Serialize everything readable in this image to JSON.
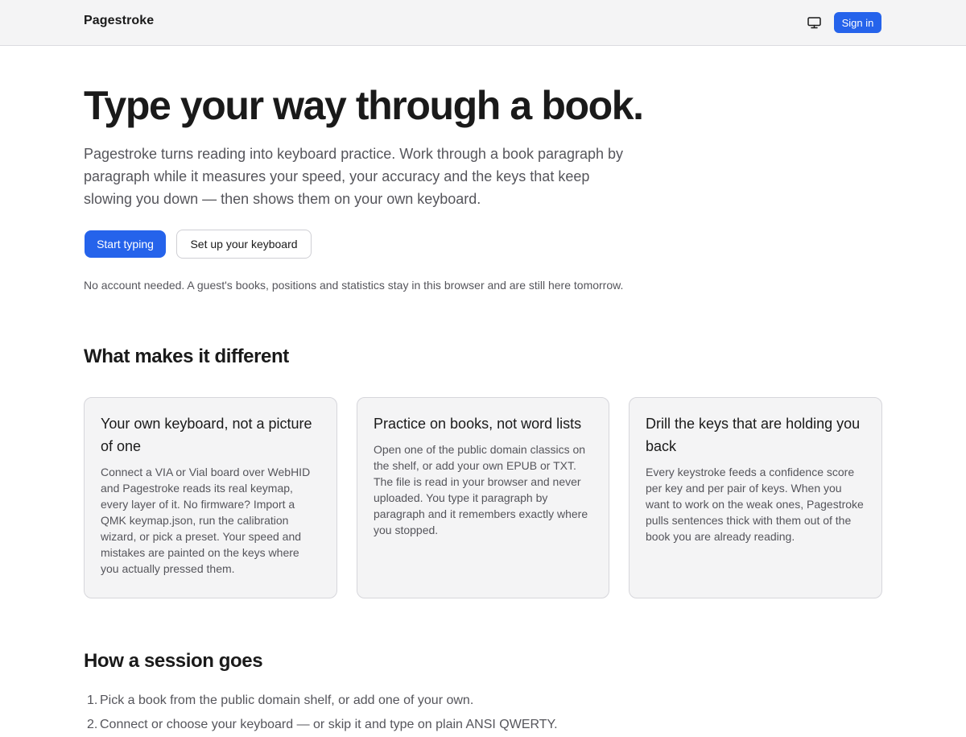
{
  "header": {
    "brand": "Pagestroke",
    "display_icon": "monitor-icon",
    "signin_label": "Sign in",
    "accent_color": "#2563eb"
  },
  "hero": {
    "title": "Type your way through a book.",
    "lead": "Pagestroke turns reading into keyboard practice. Work through a book paragraph by paragraph while it measures your speed, your accuracy and the keys that keep slowing you down — then shows them on your own keyboard.",
    "primary_label": "Start typing",
    "secondary_label": "Set up your keyboard",
    "note": "No account needed. A guest's books, positions and statistics stay in this browser and are still here tomorrow."
  },
  "features": {
    "title": "What makes it different",
    "cards": [
      {
        "title": "Your own keyboard, not a picture of one",
        "body": "Connect a VIA or Vial board over WebHID and Pagestroke reads its real keymap, every layer of it. No firmware? Import a QMK keymap.json, run the calibration wizard, or pick a preset. Your speed and mistakes are painted on the keys where you actually pressed them."
      },
      {
        "title": "Practice on books, not word lists",
        "body": "Open one of the public domain classics on the shelf, or add your own EPUB or TXT. The file is read in your browser and never uploaded. You type it paragraph by paragraph and it remembers exactly where you stopped."
      },
      {
        "title": "Drill the keys that are holding you back",
        "body": "Every keystroke feeds a confidence score per key and per pair of keys. When you want to work on the weak ones, Pagestroke pulls sentences thick with them out of the book you are already reading."
      }
    ]
  },
  "session": {
    "title": "How a session goes",
    "steps": [
      {
        "num": "1.",
        "text": "Pick a book from the public domain shelf, or add one of your own."
      },
      {
        "num": "2.",
        "text": "Connect or choose your keyboard — or skip it and type on plain ANSI QWERTY."
      }
    ]
  }
}
